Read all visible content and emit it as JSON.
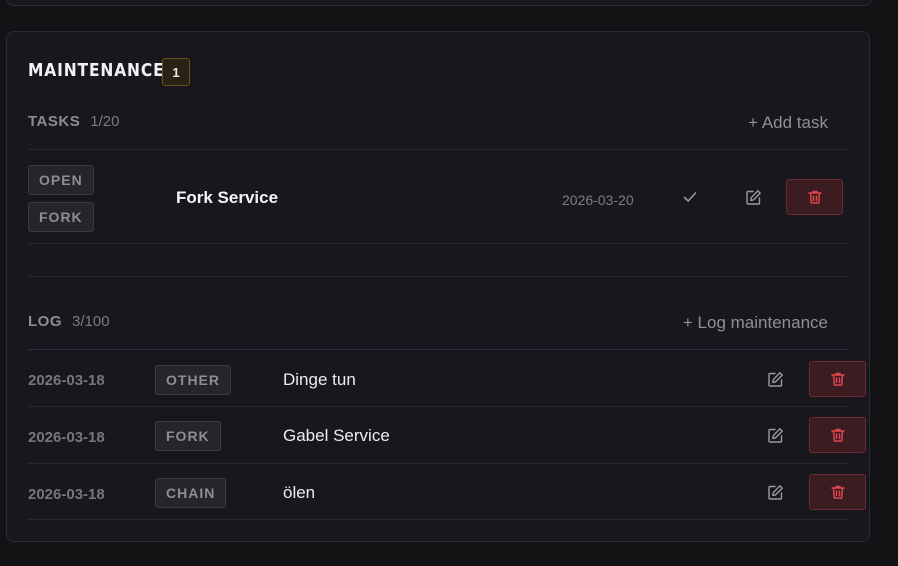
{
  "section": {
    "title": "MAINTENANCE",
    "badge_count": "1"
  },
  "tasks": {
    "label": "TASKS",
    "count": "1/20",
    "add_label": "+ Add task",
    "items": [
      {
        "tags": [
          "OPEN",
          "FORK"
        ],
        "name": "Fork Service",
        "date": "2026-03-20"
      }
    ]
  },
  "log": {
    "label": "LOG",
    "count": "3/100",
    "add_label": "+ Log maintenance",
    "entries": [
      {
        "date": "2026-03-18",
        "tag": "OTHER",
        "text": "Dinge tun"
      },
      {
        "date": "2026-03-18",
        "tag": "FORK",
        "text": "Gabel Service"
      },
      {
        "date": "2026-03-18",
        "tag": "CHAIN",
        "text": "ölen"
      }
    ]
  },
  "icons": {
    "check": "check-icon",
    "edit": "edit-icon",
    "delete": "trash-icon"
  },
  "colors": {
    "accent_badge": "#6b4e1e",
    "delete": "#e0454f",
    "background": "#131316",
    "card": "#17171d"
  }
}
